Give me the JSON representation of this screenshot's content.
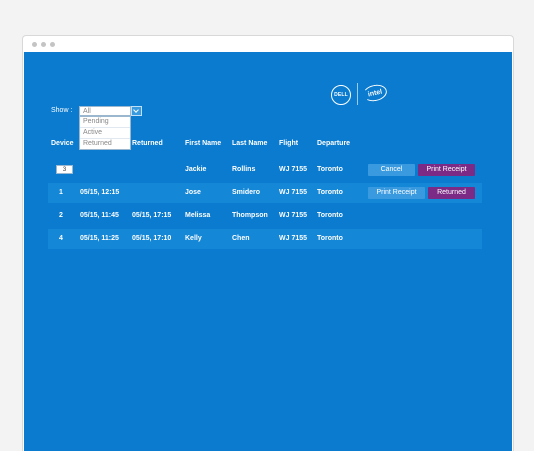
{
  "filter": {
    "label": "Show :",
    "selected": "All",
    "options": [
      "Pending",
      "Active",
      "Returned"
    ]
  },
  "table": {
    "headers": [
      "Device",
      "Returned",
      "First Name",
      "Last Name",
      "Flight",
      "Departure"
    ],
    "rows": [
      {
        "device": "3",
        "out": "",
        "returned": "",
        "first": "Jackie",
        "last": "Rollins",
        "flight": "WJ 7155",
        "departure": "Toronto",
        "btn1": "Cancel",
        "btn2": "Print Receipt"
      },
      {
        "device": "1",
        "out": "05/15, 12:15",
        "returned": "",
        "first": "Jose",
        "last": "Smidero",
        "flight": "WJ 7155",
        "departure": "Toronto",
        "btn1": "Print Receipt",
        "btn2": "Returned"
      },
      {
        "device": "2",
        "out": "05/15, 11:45",
        "returned": "05/15, 17:15",
        "first": "Melissa",
        "last": "Thompson",
        "flight": "WJ 7155",
        "departure": "Toronto"
      },
      {
        "device": "4",
        "out": "05/15, 11:25",
        "returned": "05/15, 17:10",
        "first": "Kelly",
        "last": "Chen",
        "flight": "WJ 7155",
        "departure": "Toronto"
      }
    ]
  },
  "colors": {
    "background": "#0a7bcf",
    "row_highlight": "#1587d7",
    "button_light": "#3a9ae0",
    "button_purple": "#7b2a86"
  },
  "icons": [
    "dell-logo",
    "intel-logo",
    "chevron-down-icon"
  ]
}
